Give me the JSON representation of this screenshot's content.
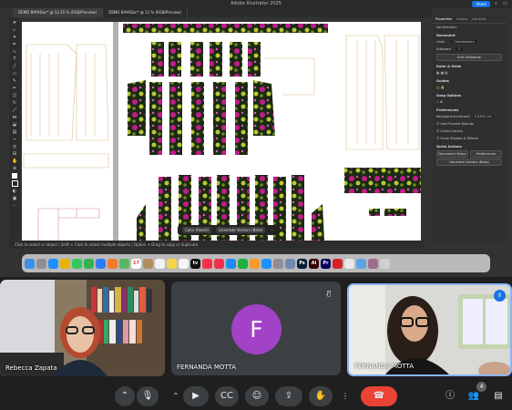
{
  "colors": {
    "accent": "#1473e6",
    "meet_bg": "#1f1f1f",
    "avatar": "#a142c7",
    "end_call": "#ea4335",
    "active_speaker_border": "#8ab4f8"
  },
  "illustrator": {
    "window_title": "Adobe Illustrator 2025",
    "share_label": "Share",
    "doc_tabs": [
      "DEMO BAYADoc* @ 12.25 % (RGB/Preview)",
      "DEMO BAYADoc* @ 11 % (RGB/Preview)"
    ],
    "status_text": "Click to select or object  |  Shift + Click to select multiple objects  |  Option + Drag to copy or duplicate",
    "floating_bar": {
      "btn1": "Color (Reset)",
      "btn2": "Generate Vectors (Beta)"
    },
    "properties": {
      "tabs": [
        "Properties",
        "Layers",
        "Libraries"
      ],
      "no_selection": "No Selection",
      "document_section": "Document",
      "units_label": "Units",
      "units_value": "Centimeters",
      "artboard_label": "Artboard",
      "artboard_value": "1",
      "edit_artboards": "Edit Artboards",
      "rulers_section": "Ruler & Grids",
      "guides_section": "Guides",
      "snap_section": "Snap Options",
      "preferences_section": "Preferences",
      "keyboard_increment_label": "Keyboard Increment",
      "keyboard_increment_value": "0.0353 cm",
      "use_preview_bounds": "Use Preview Bounds",
      "scale_corners": "Scale Corners",
      "scale_strokes": "Scale Strokes & Effects",
      "quick_actions_section": "Quick Actions",
      "document_setup": "Document Setup",
      "preferences_button": "Preferences",
      "generate_vectors": "Generate Vectors (Beta)"
    }
  },
  "dock": {
    "apps": [
      {
        "icon": "finder-icon",
        "color": "#3d8fe8",
        "label": ""
      },
      {
        "icon": "launchpad-icon",
        "color": "#8e8e93",
        "label": ""
      },
      {
        "icon": "safari-icon",
        "color": "#1e90ff",
        "label": ""
      },
      {
        "icon": "chrome-icon",
        "color": "#e9b400",
        "label": ""
      },
      {
        "icon": "messages-icon",
        "color": "#34c759",
        "label": ""
      },
      {
        "icon": "facetime-icon",
        "color": "#30b350",
        "label": ""
      },
      {
        "icon": "mail-icon",
        "color": "#2f7cf6",
        "label": ""
      },
      {
        "icon": "photos-icon",
        "color": "#f27b2a",
        "label": ""
      },
      {
        "icon": "maps-icon",
        "color": "#56b85c",
        "label": ""
      },
      {
        "icon": "calendar-icon",
        "color": "#ffffff",
        "label": "17"
      },
      {
        "icon": "contacts-icon",
        "color": "#b58c60",
        "label": ""
      },
      {
        "icon": "reminders-icon",
        "color": "#f2f2f2",
        "label": ""
      },
      {
        "icon": "notes-icon",
        "color": "#f7d54a",
        "label": ""
      },
      {
        "icon": "freeform-icon",
        "color": "#f5f5f5",
        "label": ""
      },
      {
        "icon": "tv-icon",
        "color": "#111111",
        "label": "tv"
      },
      {
        "icon": "music-icon",
        "color": "#fa2d48",
        "label": ""
      },
      {
        "icon": "news-icon",
        "color": "#f0304a",
        "label": ""
      },
      {
        "icon": "keynote-icon",
        "color": "#1c8cf4",
        "label": ""
      },
      {
        "icon": "numbers-icon",
        "color": "#21b03e",
        "label": ""
      },
      {
        "icon": "pages-icon",
        "color": "#f79a28",
        "label": ""
      },
      {
        "icon": "app-store-icon",
        "color": "#1e90ff",
        "label": ""
      },
      {
        "icon": "settings-icon",
        "color": "#8e8e93",
        "label": ""
      },
      {
        "icon": "preview-icon",
        "color": "#6e8bb2",
        "label": ""
      },
      {
        "icon": "photoshop-icon",
        "color": "#001e36",
        "label": "Ps"
      },
      {
        "icon": "illustrator-icon",
        "color": "#330000",
        "label": "Ai"
      },
      {
        "icon": "premiere-icon",
        "color": "#00005b",
        "label": "Pr"
      },
      {
        "icon": "creative-cloud-icon",
        "color": "#da1f26",
        "label": ""
      },
      {
        "icon": "finder-folder-icon",
        "color": "#e8e8e8",
        "label": ""
      },
      {
        "icon": "downloads-icon",
        "color": "#5ba4e6",
        "label": ""
      },
      {
        "icon": "image-thumb-icon",
        "color": "#a06a8a",
        "label": ""
      },
      {
        "icon": "trash-icon",
        "color": "#cfcfcf",
        "label": ""
      }
    ]
  },
  "meet": {
    "tiles": [
      {
        "name": "Rebecca Zapata"
      },
      {
        "name": "FERNANDA MOTTA",
        "initial": "F"
      },
      {
        "name": "FERNANDA MOTTA"
      }
    ],
    "participant_count": "4"
  }
}
